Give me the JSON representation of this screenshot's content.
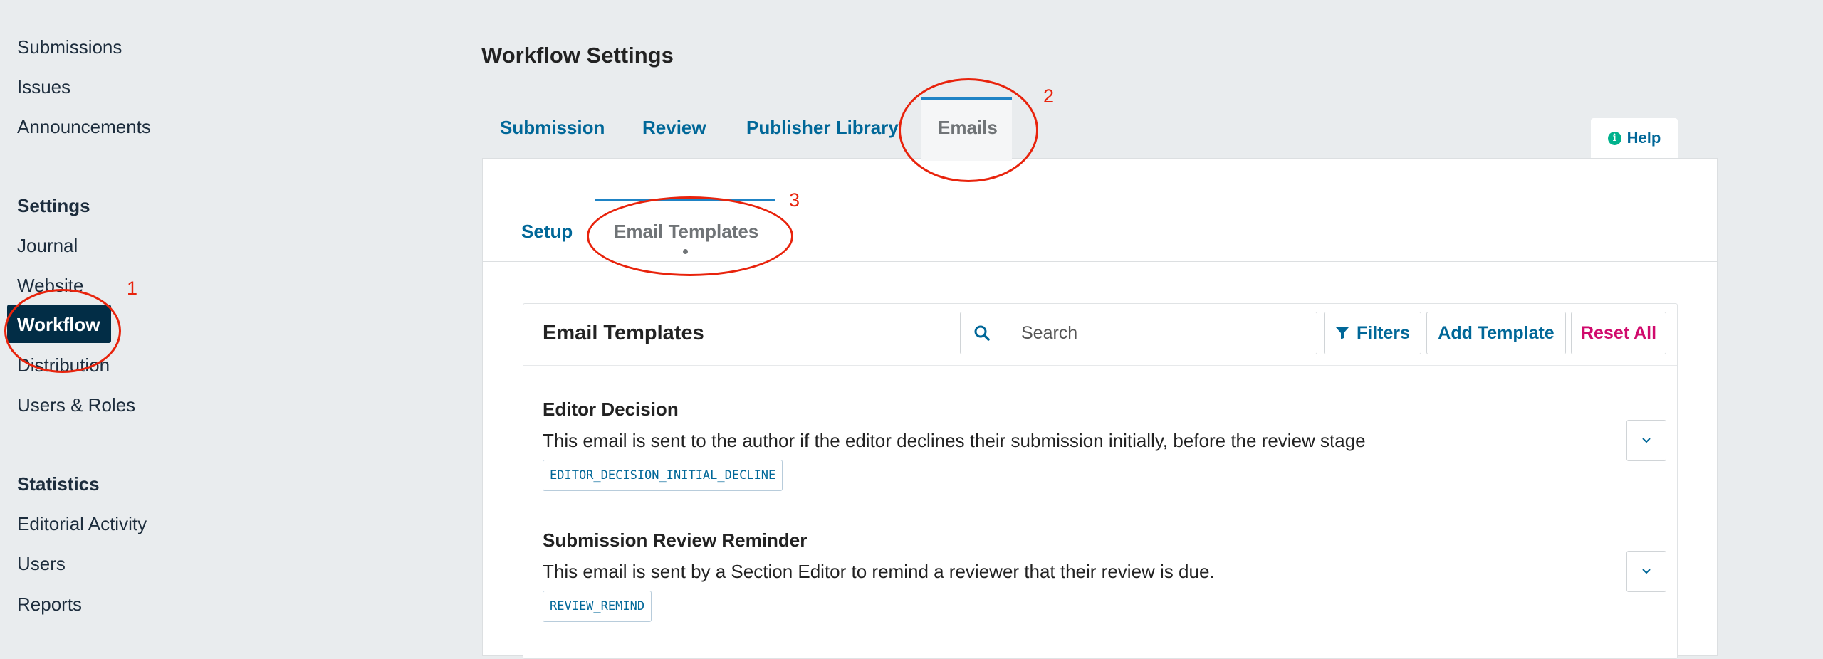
{
  "sidebar": {
    "top_links": [
      "Submissions",
      "Issues",
      "Announcements"
    ],
    "settings": {
      "heading": "Settings",
      "items": [
        "Journal",
        "Website",
        "Workflow",
        "Distribution",
        "Users & Roles"
      ],
      "active": "Workflow"
    },
    "statistics": {
      "heading": "Statistics",
      "items": [
        "Editorial Activity",
        "Users",
        "Reports"
      ]
    }
  },
  "page": {
    "title": "Workflow Settings"
  },
  "tabs": {
    "items": [
      "Submission",
      "Review",
      "Publisher Library",
      "Emails"
    ],
    "active": "Emails"
  },
  "help": {
    "label": "Help",
    "icon": "info-icon",
    "icon_glyph": "i"
  },
  "subtabs": {
    "items": [
      "Setup",
      "Email Templates"
    ],
    "active": "Email Templates"
  },
  "email_templates": {
    "title": "Email Templates",
    "search_placeholder": "Search",
    "filters_label": "Filters",
    "add_label": "Add Template",
    "reset_label": "Reset All",
    "templates": [
      {
        "name": "Editor Decision",
        "description": "This email is sent to the author if the editor declines their submission initially, before the review stage",
        "key": "EDITOR_DECISION_INITIAL_DECLINE"
      },
      {
        "name": "Submission Review Reminder",
        "description": "This email is sent by a Section Editor to remind a reviewer that their review is due.",
        "key": "REVIEW_REMIND"
      }
    ]
  },
  "annotations": [
    "1",
    "2",
    "3"
  ],
  "colors": {
    "link_blue": "#006798",
    "active_nav_bg": "#022d46",
    "tab_accent": "#1e83c5",
    "reset_red": "#d00a6c",
    "annotation_red": "#e8230c",
    "help_green": "#00b28d"
  }
}
